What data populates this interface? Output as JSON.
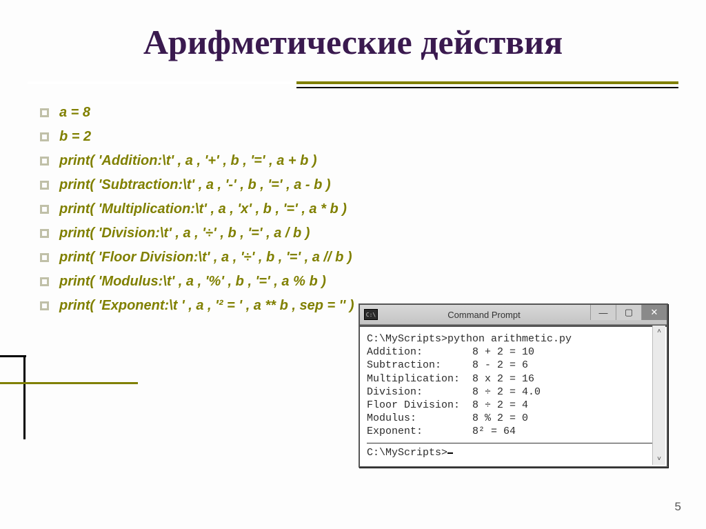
{
  "title": "Арифметические действия",
  "code_lines": [
    "a = 8",
    "b = 2",
    "print( 'Addition:\\t' , a , '+' , b , '=' , a + b )",
    "print( 'Subtraction:\\t' , a , '-' , b , '=' , a - b )",
    "print( 'Multiplication:\\t' , a , 'x' , b , '=' , a * b )",
    "print( 'Division:\\t' , a , '÷' , b , '=' , a / b )",
    "print( 'Floor Division:\\t' , a , '÷' , b , '=' , a // b )",
    "print( 'Modulus:\\t' , a , '%' , b , '=' , a % b )",
    "print( 'Exponent:\\t ' , a , '² = ' , a ** b , sep = '' )"
  ],
  "cmd": {
    "title": "Command Prompt",
    "icon_text": "C:\\",
    "btn_min": "—",
    "btn_max": "▢",
    "btn_close": "✕",
    "scroll_up": "˄",
    "scroll_down": "˅",
    "line1": "C:\\MyScripts>python arithmetic.py",
    "out1": "Addition:        8 + 2 = 10",
    "out2": "Subtraction:     8 - 2 = 6",
    "out3": "Multiplication:  8 x 2 = 16",
    "out4": "Division:        8 ÷ 2 = 4.0",
    "out5": "Floor Division:  8 ÷ 2 = 4",
    "out6": "Modulus:         8 % 2 = 0",
    "out7": "Exponent:        8² = 64",
    "prompt2": "C:\\MyScripts>"
  },
  "page_number": "5"
}
